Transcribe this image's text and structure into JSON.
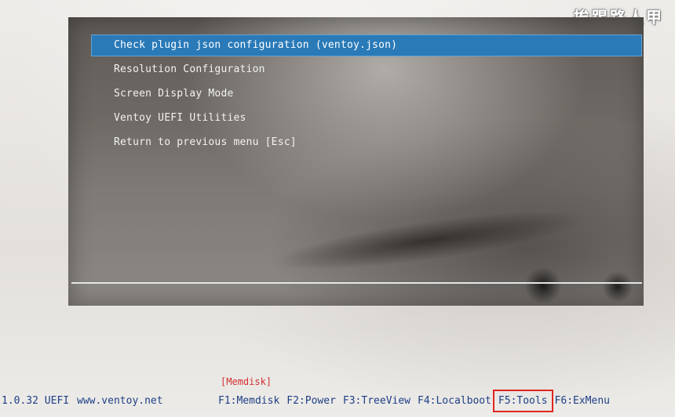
{
  "watermark": "挨踢路人甲",
  "menu": {
    "items": [
      {
        "label": "Check plugin json configuration (ventoy.json)",
        "selected": true
      },
      {
        "label": "Resolution Configuration",
        "selected": false
      },
      {
        "label": "Screen Display Mode",
        "selected": false
      },
      {
        "label": "Ventoy UEFI Utilities",
        "selected": false
      },
      {
        "label": "Return to previous menu [Esc]",
        "selected": false
      }
    ]
  },
  "status": {
    "version": "1.0.32 UEFI",
    "website": "www.ventoy.net",
    "mode_tag": "[Memdisk]"
  },
  "fkeys": [
    {
      "label": "F1:Memdisk"
    },
    {
      "label": "F2:Power"
    },
    {
      "label": "F3:TreeView"
    },
    {
      "label": "F4:Localboot"
    },
    {
      "label": "F5:Tools",
      "highlighted": true
    },
    {
      "label": "F6:ExMenu"
    }
  ],
  "colors": {
    "selection": "#2a7ab8",
    "status_text": "#1e3f86",
    "tag_text": "#d23030",
    "highlight_box": "#e0261f"
  }
}
